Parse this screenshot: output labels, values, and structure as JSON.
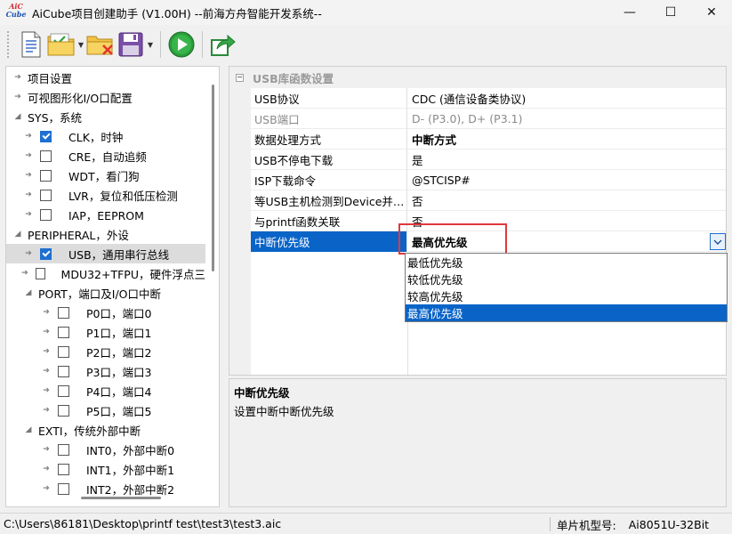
{
  "window": {
    "title": "AiCube项目创建助手 (V1.00H) --前海方舟智能开发系统--",
    "logo_top": "AiC",
    "logo_bottom": "Cube",
    "minimize_glyph": "—",
    "maximize_glyph": "☐",
    "close_glyph": "✕"
  },
  "toolbar": {
    "buttons": [
      "new-document-icon",
      "open-folder-icon",
      "delete-folder-icon",
      "save-disk-icon",
      "run-icon",
      "export-icon"
    ]
  },
  "tree": {
    "items": [
      {
        "label": "项目设置",
        "arrow": "➔",
        "checkbox": "none",
        "indent": 0
      },
      {
        "label": "可视图形化I/O口配置",
        "arrow": "➔",
        "checkbox": "none",
        "indent": 0
      },
      {
        "label": "SYS，系统",
        "arrow": "◢",
        "checkbox": "none",
        "indent": 0
      },
      {
        "label": "CLK，时钟",
        "arrow": "➔",
        "checkbox": "checked",
        "indent": 1
      },
      {
        "label": "CRE，自动追频",
        "arrow": "➔",
        "checkbox": "unchecked",
        "indent": 1
      },
      {
        "label": "WDT，看门狗",
        "arrow": "➔",
        "checkbox": "unchecked",
        "indent": 1
      },
      {
        "label": "LVR，复位和低压检测",
        "arrow": "➔",
        "checkbox": "unchecked",
        "indent": 1
      },
      {
        "label": "IAP，EEPROM",
        "arrow": "➔",
        "checkbox": "unchecked",
        "indent": 1
      },
      {
        "label": "PERIPHERAL，外设",
        "arrow": "◢",
        "checkbox": "none",
        "indent": 0
      },
      {
        "label": "USB，通用串行总线",
        "arrow": "➔",
        "checkbox": "checked",
        "indent": 1,
        "selected": true
      },
      {
        "label": "MDU32+TFPU，硬件浮点三",
        "arrow": "➔",
        "checkbox": "unchecked",
        "indent": 1
      },
      {
        "label": "PORT，端口及I/O口中断",
        "arrow": "◢",
        "checkbox": "none",
        "indent": 1
      },
      {
        "label": "P0口，端口0",
        "arrow": "➔",
        "checkbox": "unchecked",
        "indent": 2
      },
      {
        "label": "P1口，端口1",
        "arrow": "➔",
        "checkbox": "unchecked",
        "indent": 2
      },
      {
        "label": "P2口，端口2",
        "arrow": "➔",
        "checkbox": "unchecked",
        "indent": 2
      },
      {
        "label": "P3口，端口3",
        "arrow": "➔",
        "checkbox": "unchecked",
        "indent": 2
      },
      {
        "label": "P4口，端口4",
        "arrow": "➔",
        "checkbox": "unchecked",
        "indent": 2
      },
      {
        "label": "P5口，端口5",
        "arrow": "➔",
        "checkbox": "unchecked",
        "indent": 2
      },
      {
        "label": "EXTI，传统外部中断",
        "arrow": "◢",
        "checkbox": "none",
        "indent": 1
      },
      {
        "label": "INT0，外部中断0",
        "arrow": "➔",
        "checkbox": "unchecked",
        "indent": 2
      },
      {
        "label": "INT1，外部中断1",
        "arrow": "➔",
        "checkbox": "unchecked",
        "indent": 2
      },
      {
        "label": "INT2，外部中断2",
        "arrow": "➔",
        "checkbox": "unchecked",
        "indent": 2
      }
    ]
  },
  "properties": {
    "category": "USB库函数设置",
    "category_toggle": "−",
    "rows": [
      {
        "name": "USB协议",
        "value": "CDC (通信设备类协议)",
        "state": "normal"
      },
      {
        "name": "USB端口",
        "value": "D- (P3.0), D+ (P3.1)",
        "state": "disabled"
      },
      {
        "name": "数据处理方式",
        "value": "中断方式",
        "state": "bold"
      },
      {
        "name": "USB不停电下载",
        "value": "是",
        "state": "normal"
      },
      {
        "name": "ISP下载命令",
        "value": "@STCISP#",
        "state": "normal"
      },
      {
        "name": "等USB主机检测到Device并…",
        "value": "否",
        "state": "normal"
      },
      {
        "name": "与printf函数关联",
        "value": "否",
        "state": "normal"
      },
      {
        "name": "中断优先级",
        "value": "最高优先级",
        "state": "selected"
      }
    ],
    "dropdown_options": [
      "最低优先级",
      "较低优先级",
      "较高优先级",
      "最高优先级"
    ],
    "dropdown_selected_index": 3
  },
  "description": {
    "title": "中断优先级",
    "text": "设置中断中断优先级"
  },
  "status": {
    "path": "C:\\Users\\86181\\Desktop\\printf test\\test3\\test3.aic",
    "chip_label": "单片机型号:",
    "chip_value": "Ai8051U-32Bit"
  },
  "colors": {
    "selection": "#0a64c8",
    "highlight_box": "#e0393e",
    "checkbox_checked": "#1f6fd0"
  }
}
